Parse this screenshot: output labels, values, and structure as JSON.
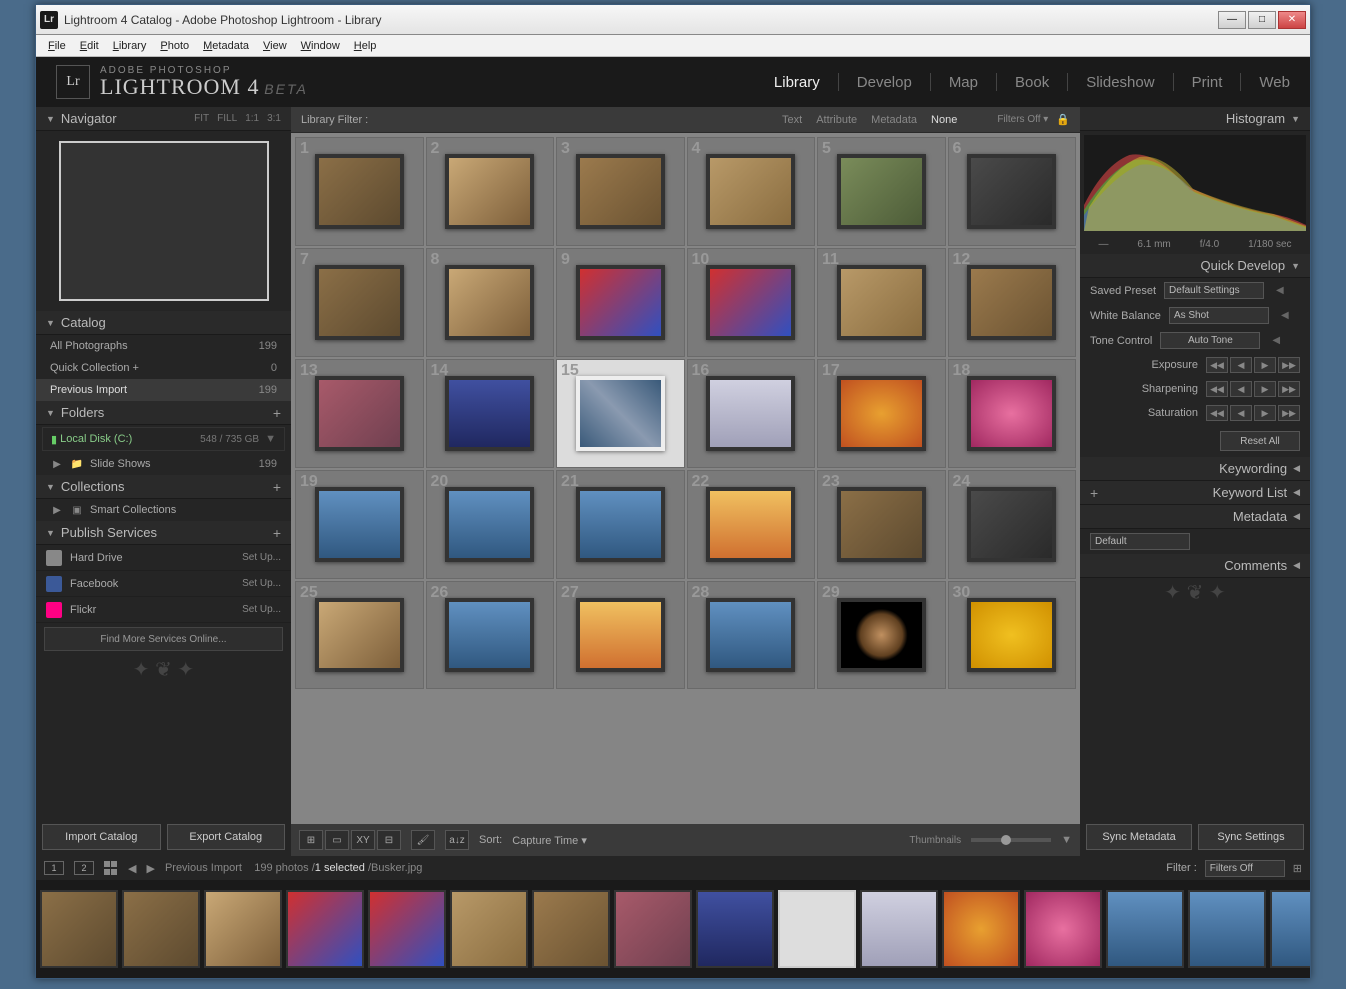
{
  "window": {
    "title": "Lightroom 4 Catalog - Adobe Photoshop Lightroom - Library"
  },
  "menubar": [
    "File",
    "Edit",
    "Library",
    "Photo",
    "Metadata",
    "View",
    "Window",
    "Help"
  ],
  "branding": {
    "line1": "ADOBE PHOTOSHOP",
    "line2": "LIGHTROOM 4",
    "beta": "BETA",
    "logo": "Lr"
  },
  "modules": [
    "Library",
    "Develop",
    "Map",
    "Book",
    "Slideshow",
    "Print",
    "Web"
  ],
  "active_module": "Library",
  "navigator": {
    "title": "Navigator",
    "modes": [
      "FIT",
      "FILL",
      "1:1",
      "3:1"
    ]
  },
  "catalog": {
    "title": "Catalog",
    "rows": [
      {
        "label": "All Photographs",
        "count": "199"
      },
      {
        "label": "Quick Collection  +",
        "count": "0"
      },
      {
        "label": "Previous Import",
        "count": "199",
        "active": true
      }
    ]
  },
  "folders": {
    "title": "Folders",
    "disk": "Local Disk (C:)",
    "disk_stats": "548 / 735 GB",
    "rows": [
      {
        "label": "Slide Shows",
        "count": "199"
      }
    ]
  },
  "collections": {
    "title": "Collections",
    "rows": [
      {
        "label": "Smart Collections"
      }
    ]
  },
  "publish": {
    "title": "Publish Services",
    "rows": [
      {
        "label": "Hard Drive",
        "color": "#888",
        "setup": "Set Up..."
      },
      {
        "label": "Facebook",
        "color": "#3b5998",
        "setup": "Set Up..."
      },
      {
        "label": "Flickr",
        "color": "#ff0084",
        "setup": "Set Up..."
      }
    ],
    "find_more": "Find More Services Online..."
  },
  "left_buttons": {
    "import": "Import Catalog",
    "export": "Export Catalog"
  },
  "libfilter": {
    "title": "Library Filter :",
    "tabs": [
      "Text",
      "Attribute",
      "Metadata",
      "None"
    ],
    "active": "None",
    "filters_off": "Filters Off"
  },
  "grid": {
    "selected": 15,
    "count": 30
  },
  "toolbar": {
    "sort_label": "Sort:",
    "sort_value": "Capture Time",
    "thumbs_label": "Thumbnails"
  },
  "histogram": {
    "title": "Histogram",
    "focal": "6.1 mm",
    "aperture": "f/4.0",
    "shutter": "1/180 sec",
    "iso_dash": "—"
  },
  "quickdev": {
    "title": "Quick Develop",
    "preset_label": "Saved Preset",
    "preset_value": "Default Settings",
    "wb_label": "White Balance",
    "wb_value": "As Shot",
    "tone_label": "Tone Control",
    "autotone": "Auto Tone",
    "sliders": [
      "Exposure",
      "Sharpening",
      "Saturation"
    ],
    "reset": "Reset All"
  },
  "right_panels": [
    "Keywording",
    "Keyword List",
    "Metadata",
    "Comments"
  ],
  "metadata_preset": "Default",
  "sync": {
    "meta": "Sync Metadata",
    "settings": "Sync Settings"
  },
  "filmstrip": {
    "crumb_source": "Previous Import",
    "crumb_count": "199 photos",
    "crumb_selected": "1 selected",
    "crumb_file": "Busker.jpg",
    "filter_label": "Filter :",
    "filter_value": "Filters Off",
    "monitor1": "1",
    "monitor2": "2"
  }
}
